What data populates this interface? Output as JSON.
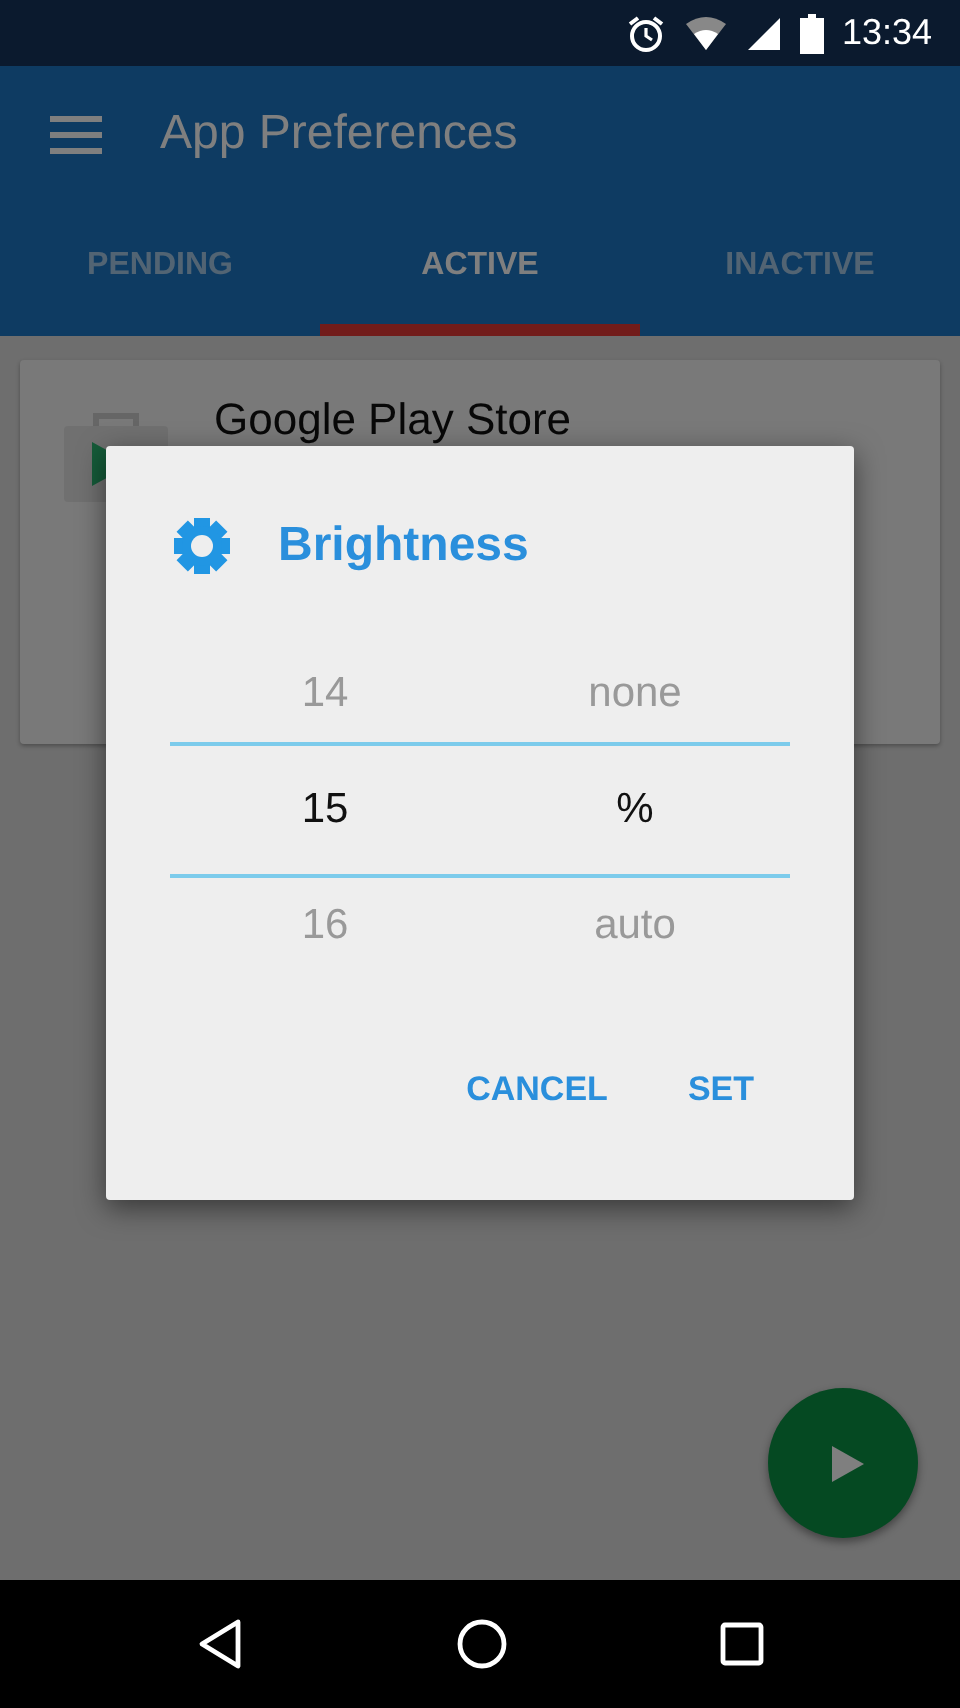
{
  "status_bar": {
    "time": "13:34"
  },
  "app_bar": {
    "title": "App Preferences"
  },
  "tabs": [
    {
      "label": "PENDING",
      "selected": false
    },
    {
      "label": "ACTIVE",
      "selected": true
    },
    {
      "label": "INACTIVE",
      "selected": false
    }
  ],
  "list": [
    {
      "title": "Google Play Store"
    }
  ],
  "dialog": {
    "title": "Brightness",
    "pickers": [
      {
        "items": [
          {
            "label": "14",
            "selected": false
          },
          {
            "label": "15",
            "selected": true
          },
          {
            "label": "16",
            "selected": false
          }
        ]
      },
      {
        "items": [
          {
            "label": "none",
            "selected": false
          },
          {
            "label": "%",
            "selected": true
          },
          {
            "label": "auto",
            "selected": false
          }
        ]
      }
    ],
    "buttons": [
      "CANCEL",
      "SET"
    ]
  }
}
